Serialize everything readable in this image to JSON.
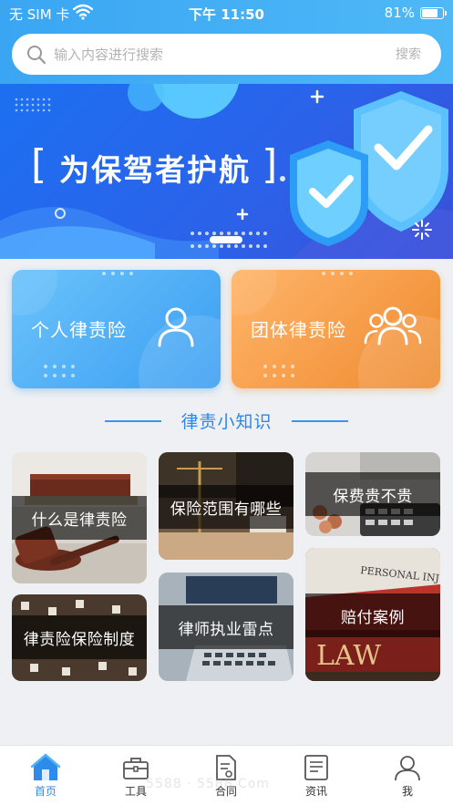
{
  "status_bar": {
    "carrier": "无 SIM 卡",
    "time": "下午 11:50",
    "battery": "81%",
    "battery_level": 0.81
  },
  "search": {
    "placeholder": "输入内容进行搜索",
    "button": "搜索"
  },
  "banner": {
    "title": "为保驾者护航",
    "bracket_left": "[",
    "bracket_right": "]"
  },
  "cards": [
    {
      "label": "个人律责险",
      "icon": "person-icon",
      "color": "#3a9ef2"
    },
    {
      "label": "团体律责险",
      "icon": "group-icon",
      "color": "#ef8a2f"
    }
  ],
  "section_title": "律责小知识",
  "tiles": [
    {
      "caption": "什么是律责险",
      "icon": "gavel-books-image"
    },
    {
      "caption": "保险范围有哪些",
      "icon": "scales-justice-image"
    },
    {
      "caption": "保费贵不贵",
      "icon": "calculator-coins-image"
    },
    {
      "caption": "律责险保险制度",
      "icon": "dice-letters-image"
    },
    {
      "caption": "律师执业雷点",
      "icon": "laptop-image"
    },
    {
      "caption": "赔付案例",
      "icon": "law-book-image",
      "book_text": "PERSONAL INJURY",
      "cover_text": "LAW"
    }
  ],
  "tabs": [
    {
      "label": "首页",
      "icon": "home-icon",
      "active": true
    },
    {
      "label": "工具",
      "icon": "toolbox-icon",
      "active": false
    },
    {
      "label": "合同",
      "icon": "contract-icon",
      "active": false
    },
    {
      "label": "资讯",
      "icon": "news-icon",
      "active": false
    },
    {
      "label": "我",
      "icon": "profile-icon",
      "active": false
    }
  ],
  "watermark": "5588 · 5588.Com",
  "colors": {
    "primary": "#2f8bea",
    "header": "#3aa6f3",
    "banner": "#1d6ff1",
    "card_blue": "#3a9ef2",
    "card_orange": "#ef8a2f"
  }
}
